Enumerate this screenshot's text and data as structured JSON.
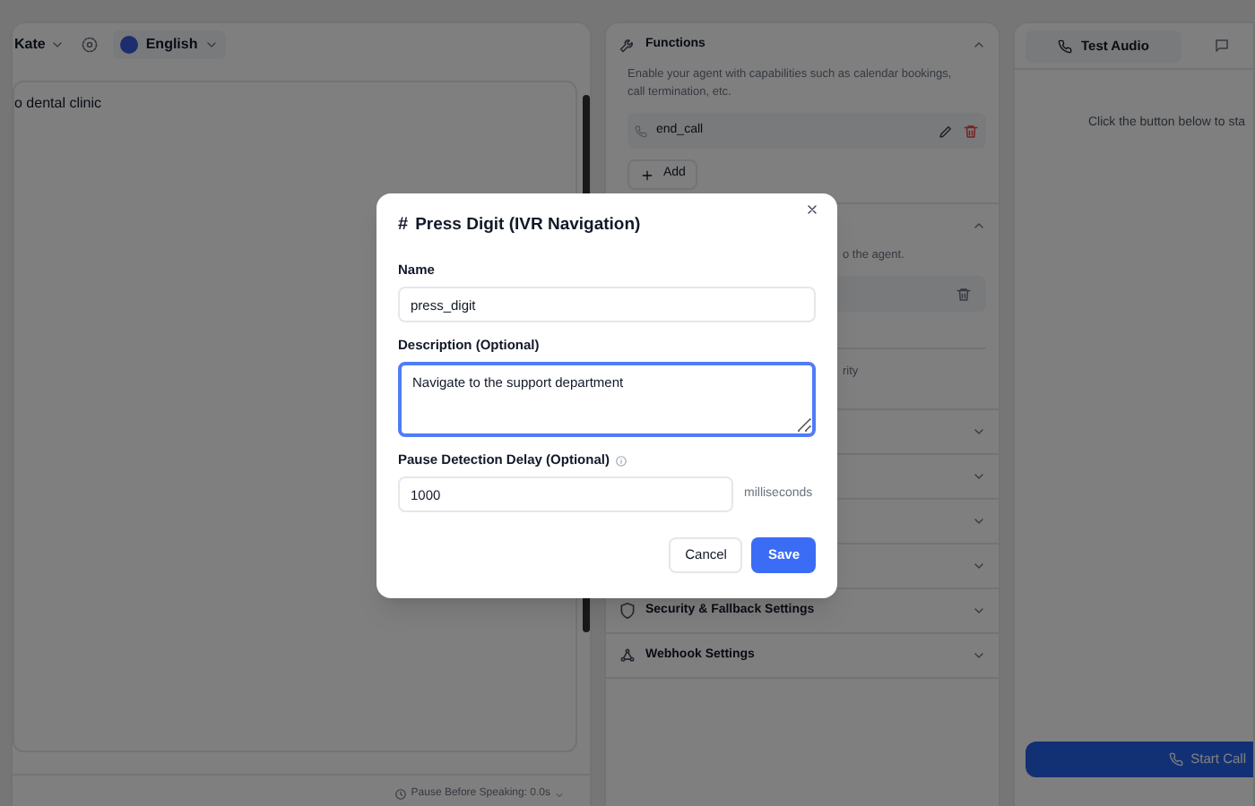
{
  "editor": {
    "voice": "Kate",
    "language": "English",
    "prompt_text": "o dental clinic",
    "pause_setting": "Pause Before Speaking: 0.0s"
  },
  "settings": [
    {
      "kind": "functions",
      "title": "Functions",
      "expanded": true,
      "description": "Enable your agent with capabilities such as calendar bookings, call termination, etc.",
      "items": [
        {
          "name": "end_call"
        }
      ],
      "add_label": "Add"
    },
    {
      "kind": "partial",
      "expanded": true,
      "description": "o the agent.",
      "footer_text": "rity"
    },
    {
      "kind": "hidden",
      "expanded": false
    },
    {
      "kind": "hidden",
      "expanded": false
    },
    {
      "kind": "hidden",
      "expanded": false
    },
    {
      "kind": "hidden",
      "expanded": false
    },
    {
      "kind": "security",
      "title": "Security & Fallback Settings",
      "expanded": false
    },
    {
      "kind": "webhook",
      "title": "Webhook Settings",
      "expanded": false
    }
  ],
  "test_panel": {
    "tabs": [
      {
        "label": "Test Audio",
        "selected": true
      }
    ],
    "hint": "Click the button below to sta",
    "start_label": "Start Call"
  },
  "dialog": {
    "title": "Press Digit (IVR Navigation)",
    "title_icon": "#",
    "fields": [
      {
        "kind": "text",
        "label": "Name",
        "value": "press_digit",
        "focused": false
      },
      {
        "kind": "textarea",
        "label": "Description (Optional)",
        "value": "Navigate to the support department ",
        "focused": true
      },
      {
        "kind": "number",
        "label": "Pause Detection Delay (Optional)",
        "value": "1000",
        "unit": "milliseconds",
        "info": true,
        "focused": false
      }
    ],
    "cancel_label": "Cancel",
    "save_label": "Save"
  }
}
